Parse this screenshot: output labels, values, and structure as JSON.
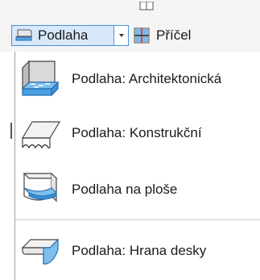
{
  "toolbar": {
    "floor_button_label": "Podlaha",
    "mullion_button_label": "Příčel"
  },
  "menu": {
    "items": [
      {
        "label": "Podlaha: Architektonická",
        "icon": "floor-architectural-icon"
      },
      {
        "label": "Podlaha: Konstrukční",
        "icon": "floor-structural-icon"
      },
      {
        "label": "Podlaha na ploše",
        "icon": "floor-by-face-icon"
      },
      {
        "label": "Podlaha: Hrana desky",
        "icon": "slab-edge-icon"
      }
    ]
  },
  "colors": {
    "accent": "#4a90d9",
    "highlight_bg": "#d7e8fa",
    "icon_blue": "#3a8fd6"
  }
}
